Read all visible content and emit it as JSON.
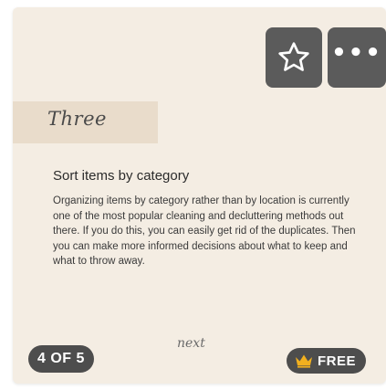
{
  "card": {
    "step_label": "Three",
    "title": "Sort items by category",
    "body": "Organizing items by category rather than by location is currently one of the most popular cleaning and decluttering methods out there. If you do this, you can easily get rid of the duplicates. Then you can make more informed decisions about what to keep and what to throw away.",
    "next_label": "next",
    "progress": "4 OF 5",
    "free_label": "FREE"
  },
  "actions": {
    "favorite_icon": "star-outline-icon",
    "more_label": "•••"
  },
  "colors": {
    "card_bg": "#f4ede3",
    "band": "#e9dccb",
    "button_bg": "#5b5b5b",
    "badge_bg": "#4d4d4d",
    "crown": "#f2b01e"
  }
}
